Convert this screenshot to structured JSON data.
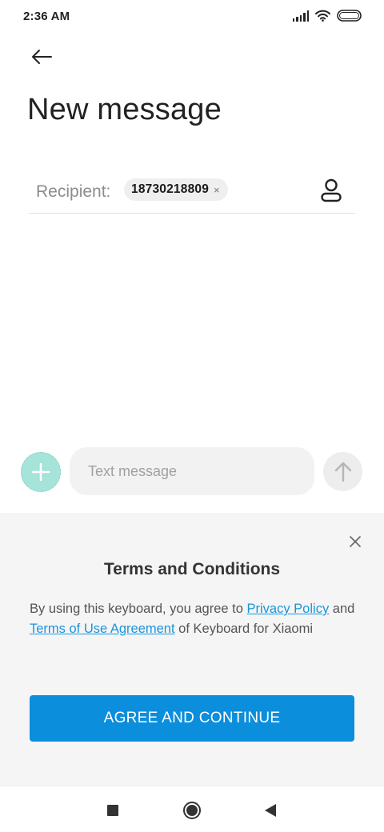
{
  "status_bar": {
    "time": "2:36 AM",
    "icons": [
      "signal-icon",
      "wifi-icon",
      "battery-icon"
    ]
  },
  "header": {
    "back_icon": "arrow-left-icon",
    "title": "New message"
  },
  "recipient": {
    "label": "Recipient:",
    "chip_value": "18730218809",
    "chip_remove": "×",
    "contact_icon": "person-icon"
  },
  "compose": {
    "attach_icon": "plus-icon",
    "placeholder": "Text message",
    "value": "",
    "send_icon": "arrow-up-icon"
  },
  "terms": {
    "close_icon": "close-icon",
    "title": "Terms and Conditions",
    "text_part1": "By using this keyboard, you agree to ",
    "link_privacy": "Privacy Policy",
    "text_part2": " and ",
    "link_terms": "Terms of Use Agreement",
    "text_part3": " of Keyboard for Xiaomi",
    "button_label": "AGREE AND CONTINUE"
  },
  "nav_bar": {
    "icons": [
      "square-icon",
      "circle-icon",
      "triangle-back-icon"
    ]
  },
  "colors": {
    "accent": "#0b8edc",
    "link": "#1a95db",
    "attach_button": "#a6e3d8",
    "panel_background": "#f5f5f5"
  }
}
